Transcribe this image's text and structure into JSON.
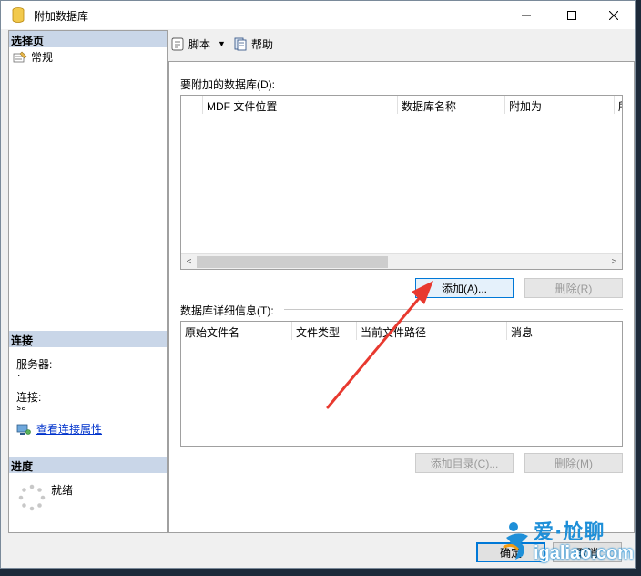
{
  "window": {
    "title": "附加数据库",
    "icon": "database-icon"
  },
  "left_pane": {
    "select_page_header": "选择页",
    "pages": [
      {
        "label": "常规",
        "icon": "general-page-icon"
      }
    ],
    "connection_header": "连接",
    "server_label": "服务器:",
    "server_value": ".",
    "connection_label": "连接:",
    "connection_value": "sa",
    "view_connection_link": "查看连接属性",
    "progress_header": "进度",
    "progress_status": "就绪"
  },
  "toolbar": {
    "script_label": "脚本",
    "help_label": "帮助"
  },
  "main": {
    "databases_label": "要附加的数据库(D):",
    "databases_columns": [
      "",
      "MDF 文件位置",
      "数据库名称",
      "附加为",
      "所"
    ],
    "add_button": "添加(A)...",
    "remove_button": "删除(R)",
    "details_label": "数据库详细信息(T):",
    "details_columns": [
      "原始文件名",
      "文件类型",
      "当前文件路径",
      "消息"
    ],
    "add_catalog_button": "添加目录(C)...",
    "remove_details_button": "删除(M)"
  },
  "footer": {
    "ok_button": "确定",
    "cancel_button": "取消"
  },
  "watermark": {
    "cn": "爱·尬聊",
    "en": "igaliao.com"
  },
  "colors": {
    "section_header": "#c9d6e8",
    "accent": "#0078d7",
    "annotation_arrow": "#e8392f",
    "watermark_blue": "#1e8fd8"
  }
}
